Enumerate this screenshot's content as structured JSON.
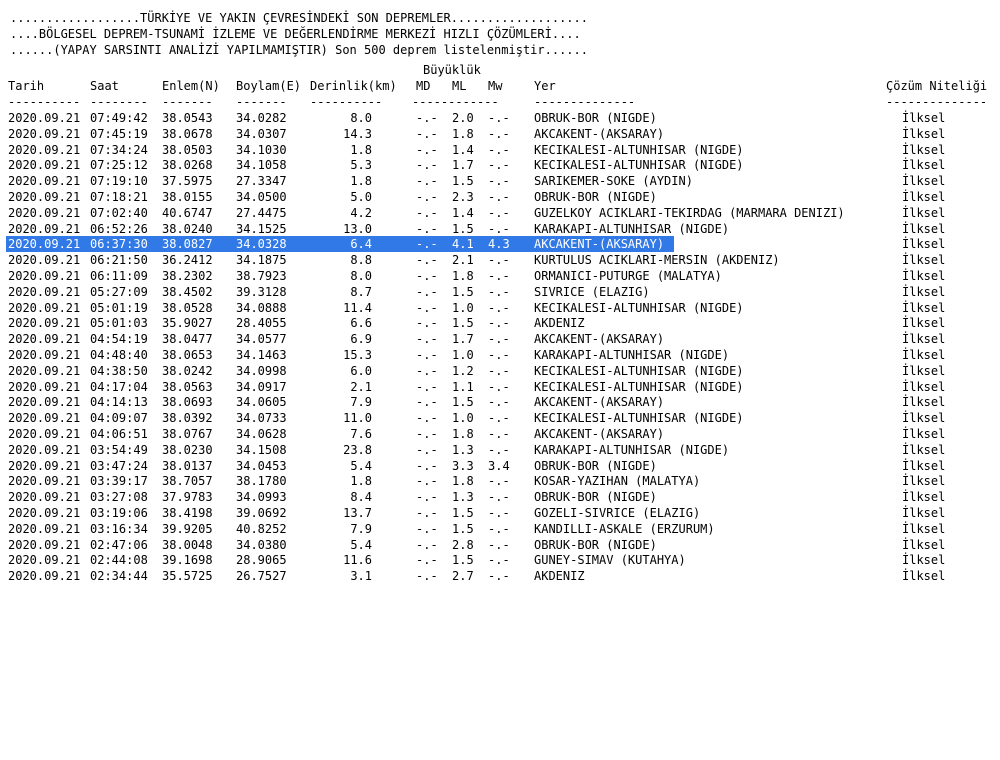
{
  "colors": {
    "background": "#ffffff",
    "text": "#000000",
    "selection_bg": "#3079e6",
    "selection_text": "#ffffff"
  },
  "header": {
    "line1": "..................TÜRKİYE VE YAKIN ÇEVRESİNDEKİ SON DEPREMLER...................",
    "line2": "....BÖLGESEL DEPREM-TSUNAMİ İZLEME VE DEĞERLENDİRME MERKEZİ HIZLI ÇÖZÜMLERİ....",
    "line3": "......(YAPAY SARSINTI ANALİZİ YAPILMAMIŞTIR) Son 500 deprem listelenmiştir......"
  },
  "columns": {
    "group_label": "Büyüklük",
    "tarih": "Tarih",
    "saat": "Saat",
    "enlem": "Enlem(N)",
    "boylam": "Boylam(E)",
    "derinlik": "Derinlik(km)",
    "md": "MD",
    "ml": "ML",
    "mw": "Mw",
    "yer": "Yer",
    "nitelik": "Çözüm Niteliği"
  },
  "separators": {
    "tarih": "----------",
    "saat": "--------",
    "enlem": "-------",
    "boylam": "-------",
    "derinlik": "----------",
    "md": "------------",
    "yer": "--------------",
    "nitelik": "--------------"
  },
  "rows": [
    {
      "tarih": "2020.09.21",
      "saat": "07:49:42",
      "enlem": "38.0543",
      "boylam": "34.0282",
      "derinlik": "8.0",
      "md": "-.-",
      "ml": "2.0",
      "mw": "-.-",
      "yer": "OBRUK-BOR (NIGDE)",
      "nitelik": "İlksel"
    },
    {
      "tarih": "2020.09.21",
      "saat": "07:45:19",
      "enlem": "38.0678",
      "boylam": "34.0307",
      "derinlik": "14.3",
      "md": "-.-",
      "ml": "1.8",
      "mw": "-.-",
      "yer": "AKCAKENT-(AKSARAY)",
      "nitelik": "İlksel"
    },
    {
      "tarih": "2020.09.21",
      "saat": "07:34:24",
      "enlem": "38.0503",
      "boylam": "34.1030",
      "derinlik": "1.8",
      "md": "-.-",
      "ml": "1.4",
      "mw": "-.-",
      "yer": "KECIKALESI-ALTUNHISAR (NIGDE)",
      "nitelik": "İlksel"
    },
    {
      "tarih": "2020.09.21",
      "saat": "07:25:12",
      "enlem": "38.0268",
      "boylam": "34.1058",
      "derinlik": "5.3",
      "md": "-.-",
      "ml": "1.7",
      "mw": "-.-",
      "yer": "KECIKALESI-ALTUNHISAR (NIGDE)",
      "nitelik": "İlksel"
    },
    {
      "tarih": "2020.09.21",
      "saat": "07:19:10",
      "enlem": "37.5975",
      "boylam": "27.3347",
      "derinlik": "1.8",
      "md": "-.-",
      "ml": "1.5",
      "mw": "-.-",
      "yer": "SARIKEMER-SOKE (AYDIN)",
      "nitelik": "İlksel"
    },
    {
      "tarih": "2020.09.21",
      "saat": "07:18:21",
      "enlem": "38.0155",
      "boylam": "34.0500",
      "derinlik": "5.0",
      "md": "-.-",
      "ml": "2.3",
      "mw": "-.-",
      "yer": "OBRUK-BOR (NIGDE)",
      "nitelik": "İlksel"
    },
    {
      "tarih": "2020.09.21",
      "saat": "07:02:40",
      "enlem": "40.6747",
      "boylam": "27.4475",
      "derinlik": "4.2",
      "md": "-.-",
      "ml": "1.4",
      "mw": "-.-",
      "yer": "GUZELKOY ACIKLARI-TEKIRDAG (MARMARA DENIZI)",
      "nitelik": "İlksel"
    },
    {
      "tarih": "2020.09.21",
      "saat": "06:52:26",
      "enlem": "38.0240",
      "boylam": "34.1525",
      "derinlik": "13.0",
      "md": "-.-",
      "ml": "1.5",
      "mw": "-.-",
      "yer": "KARAKAPI-ALTUNHISAR (NIGDE)",
      "nitelik": "İlksel"
    },
    {
      "tarih": "2020.09.21",
      "saat": "06:37:30",
      "enlem": "38.0827",
      "boylam": "34.0328",
      "derinlik": "6.4",
      "md": "-.-",
      "ml": "4.1",
      "mw": "4.3",
      "yer": "AKCAKENT-(AKSARAY)",
      "nitelik": "İlksel",
      "selected": true
    },
    {
      "tarih": "2020.09.21",
      "saat": "06:21:50",
      "enlem": "36.2412",
      "boylam": "34.1875",
      "derinlik": "8.8",
      "md": "-.-",
      "ml": "2.1",
      "mw": "-.-",
      "yer": "KURTULUS ACIKLARI-MERSIN (AKDENIZ)",
      "nitelik": "İlksel"
    },
    {
      "tarih": "2020.09.21",
      "saat": "06:11:09",
      "enlem": "38.2302",
      "boylam": "38.7923",
      "derinlik": "8.0",
      "md": "-.-",
      "ml": "1.8",
      "mw": "-.-",
      "yer": "ORMANICI-PUTURGE (MALATYA)",
      "nitelik": "İlksel"
    },
    {
      "tarih": "2020.09.21",
      "saat": "05:27:09",
      "enlem": "38.4502",
      "boylam": "39.3128",
      "derinlik": "8.7",
      "md": "-.-",
      "ml": "1.5",
      "mw": "-.-",
      "yer": "SIVRICE (ELAZIG)",
      "nitelik": "İlksel"
    },
    {
      "tarih": "2020.09.21",
      "saat": "05:01:19",
      "enlem": "38.0528",
      "boylam": "34.0888",
      "derinlik": "11.4",
      "md": "-.-",
      "ml": "1.0",
      "mw": "-.-",
      "yer": "KECIKALESI-ALTUNHISAR (NIGDE)",
      "nitelik": "İlksel"
    },
    {
      "tarih": "2020.09.21",
      "saat": "05:01:03",
      "enlem": "35.9027",
      "boylam": "28.4055",
      "derinlik": "6.6",
      "md": "-.-",
      "ml": "1.5",
      "mw": "-.-",
      "yer": "AKDENIZ",
      "nitelik": "İlksel"
    },
    {
      "tarih": "2020.09.21",
      "saat": "04:54:19",
      "enlem": "38.0477",
      "boylam": "34.0577",
      "derinlik": "6.9",
      "md": "-.-",
      "ml": "1.7",
      "mw": "-.-",
      "yer": "AKCAKENT-(AKSARAY)",
      "nitelik": "İlksel"
    },
    {
      "tarih": "2020.09.21",
      "saat": "04:48:40",
      "enlem": "38.0653",
      "boylam": "34.1463",
      "derinlik": "15.3",
      "md": "-.-",
      "ml": "1.0",
      "mw": "-.-",
      "yer": "KARAKAPI-ALTUNHISAR (NIGDE)",
      "nitelik": "İlksel"
    },
    {
      "tarih": "2020.09.21",
      "saat": "04:38:50",
      "enlem": "38.0242",
      "boylam": "34.0998",
      "derinlik": "6.0",
      "md": "-.-",
      "ml": "1.2",
      "mw": "-.-",
      "yer": "KECIKALESI-ALTUNHISAR (NIGDE)",
      "nitelik": "İlksel"
    },
    {
      "tarih": "2020.09.21",
      "saat": "04:17:04",
      "enlem": "38.0563",
      "boylam": "34.0917",
      "derinlik": "2.1",
      "md": "-.-",
      "ml": "1.1",
      "mw": "-.-",
      "yer": "KECIKALESI-ALTUNHISAR (NIGDE)",
      "nitelik": "İlksel"
    },
    {
      "tarih": "2020.09.21",
      "saat": "04:14:13",
      "enlem": "38.0693",
      "boylam": "34.0605",
      "derinlik": "7.9",
      "md": "-.-",
      "ml": "1.5",
      "mw": "-.-",
      "yer": "AKCAKENT-(AKSARAY)",
      "nitelik": "İlksel"
    },
    {
      "tarih": "2020.09.21",
      "saat": "04:09:07",
      "enlem": "38.0392",
      "boylam": "34.0733",
      "derinlik": "11.0",
      "md": "-.-",
      "ml": "1.0",
      "mw": "-.-",
      "yer": "KECIKALESI-ALTUNHISAR (NIGDE)",
      "nitelik": "İlksel"
    },
    {
      "tarih": "2020.09.21",
      "saat": "04:06:51",
      "enlem": "38.0767",
      "boylam": "34.0628",
      "derinlik": "7.6",
      "md": "-.-",
      "ml": "1.8",
      "mw": "-.-",
      "yer": "AKCAKENT-(AKSARAY)",
      "nitelik": "İlksel"
    },
    {
      "tarih": "2020.09.21",
      "saat": "03:54:49",
      "enlem": "38.0230",
      "boylam": "34.1508",
      "derinlik": "23.8",
      "md": "-.-",
      "ml": "1.3",
      "mw": "-.-",
      "yer": "KARAKAPI-ALTUNHISAR (NIGDE)",
      "nitelik": "İlksel"
    },
    {
      "tarih": "2020.09.21",
      "saat": "03:47:24",
      "enlem": "38.0137",
      "boylam": "34.0453",
      "derinlik": "5.4",
      "md": "-.-",
      "ml": "3.3",
      "mw": "3.4",
      "yer": "OBRUK-BOR (NIGDE)",
      "nitelik": "İlksel"
    },
    {
      "tarih": "2020.09.21",
      "saat": "03:39:17",
      "enlem": "38.7057",
      "boylam": "38.1780",
      "derinlik": "1.8",
      "md": "-.-",
      "ml": "1.8",
      "mw": "-.-",
      "yer": "KOSAR-YAZIHAN (MALATYA)",
      "nitelik": "İlksel"
    },
    {
      "tarih": "2020.09.21",
      "saat": "03:27:08",
      "enlem": "37.9783",
      "boylam": "34.0993",
      "derinlik": "8.4",
      "md": "-.-",
      "ml": "1.3",
      "mw": "-.-",
      "yer": "OBRUK-BOR (NIGDE)",
      "nitelik": "İlksel"
    },
    {
      "tarih": "2020.09.21",
      "saat": "03:19:06",
      "enlem": "38.4198",
      "boylam": "39.0692",
      "derinlik": "13.7",
      "md": "-.-",
      "ml": "1.5",
      "mw": "-.-",
      "yer": "GOZELI-SIVRICE (ELAZIG)",
      "nitelik": "İlksel"
    },
    {
      "tarih": "2020.09.21",
      "saat": "03:16:34",
      "enlem": "39.9205",
      "boylam": "40.8252",
      "derinlik": "7.9",
      "md": "-.-",
      "ml": "1.5",
      "mw": "-.-",
      "yer": "KANDILLI-ASKALE (ERZURUM)",
      "nitelik": "İlksel"
    },
    {
      "tarih": "2020.09.21",
      "saat": "02:47:06",
      "enlem": "38.0048",
      "boylam": "34.0380",
      "derinlik": "5.4",
      "md": "-.-",
      "ml": "2.8",
      "mw": "-.-",
      "yer": "OBRUK-BOR (NIGDE)",
      "nitelik": "İlksel"
    },
    {
      "tarih": "2020.09.21",
      "saat": "02:44:08",
      "enlem": "39.1698",
      "boylam": "28.9065",
      "derinlik": "11.6",
      "md": "-.-",
      "ml": "1.5",
      "mw": "-.-",
      "yer": "GUNEY-SIMAV (KUTAHYA)",
      "nitelik": "İlksel"
    },
    {
      "tarih": "2020.09.21",
      "saat": "02:34:44",
      "enlem": "35.5725",
      "boylam": "26.7527",
      "derinlik": "3.1",
      "md": "-.-",
      "ml": "2.7",
      "mw": "-.-",
      "yer": "AKDENIZ",
      "nitelik": "İlksel"
    }
  ]
}
